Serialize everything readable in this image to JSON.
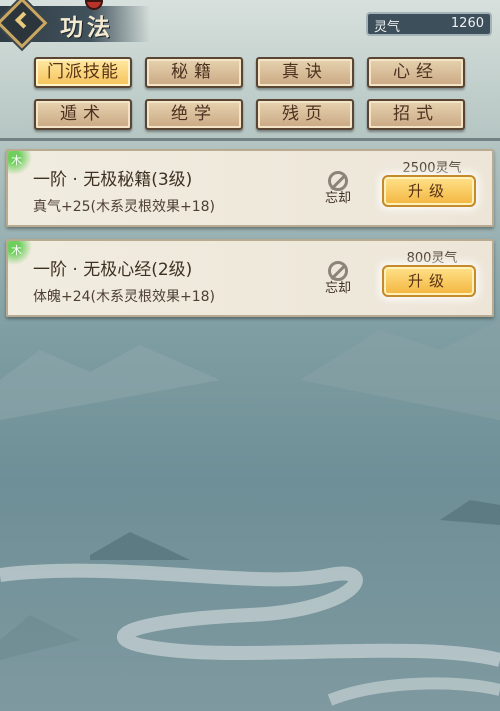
{
  "header": {
    "title": "功法",
    "currency_label": "灵气",
    "currency_value": "1260"
  },
  "tabs": [
    {
      "label": "门派技能",
      "active": true
    },
    {
      "label": "秘籍",
      "active": false
    },
    {
      "label": "真诀",
      "active": false
    },
    {
      "label": "心经",
      "active": false
    },
    {
      "label": "遁术",
      "active": false
    },
    {
      "label": "绝学",
      "active": false
    },
    {
      "label": "残页",
      "active": false
    },
    {
      "label": "招式",
      "active": false
    }
  ],
  "skills": [
    {
      "element": "木",
      "name": "一阶 · 无极秘籍(3级)",
      "desc": "真气+25(木系灵根效果+18)",
      "forget_label": "忘却",
      "cost": "2500灵气",
      "upgrade_label": "升级"
    },
    {
      "element": "木",
      "name": "一阶 · 无极心经(2级)",
      "desc": "体魄+24(木系灵根效果+18)",
      "forget_label": "忘却",
      "cost": "800灵气",
      "upgrade_label": "升级"
    }
  ],
  "colors": {
    "active_tab": "#f5c25a",
    "tab": "#caa883",
    "element_wood": "#6fcf5d"
  },
  "icons": {
    "back": "chevron-left-icon",
    "forget": "prohibited-icon"
  }
}
